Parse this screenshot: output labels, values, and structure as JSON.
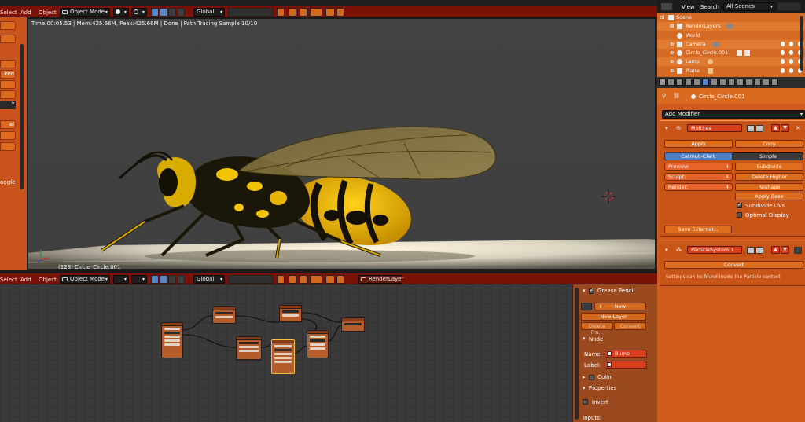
{
  "top_header": {
    "select": "Select",
    "add": "Add",
    "object": "Object",
    "mode": "Object Mode",
    "orientation": "Global"
  },
  "viewport": {
    "render_info": "Time:00:05.53 | Mem:425.66M, Peak:425.66M | Done | Path Tracing Sample 10/10",
    "object_label": "(128) Circle_Circle.001"
  },
  "left_shelf": {
    "label_ked": "ked",
    "label_al": "al",
    "label_toggle": "oggle"
  },
  "node_header": {
    "select": "Select",
    "add": "Add",
    "object": "Object",
    "mode": "Object Mode",
    "orientation": "Global",
    "render_layer": "RenderLayer"
  },
  "node_panel": {
    "grease_pencil": "Grease Pencil",
    "new": "New",
    "new_layer": "New Layer",
    "delete_frame": "Delete Fra...",
    "convert": "Convert",
    "node_section": "Node",
    "name_label": "Name:",
    "name_value": "Bump",
    "label_label": "Label:",
    "color_section": "Color",
    "properties_section": "Properties",
    "invert": "Invert",
    "inputs": "Inputs:"
  },
  "outliner": {
    "view": "View",
    "search": "Search",
    "scenes": "All Scenes",
    "items": [
      {
        "label": "Scene"
      },
      {
        "label": "RenderLayers"
      },
      {
        "label": "World"
      },
      {
        "label": "Camera"
      },
      {
        "label": "Circle_Circle.001"
      },
      {
        "label": "Lamp"
      },
      {
        "label": "Plane"
      }
    ]
  },
  "properties": {
    "context_object": "Circle_Circle.001",
    "add_modifier": "Add Modifier",
    "multires": {
      "name": "Multires",
      "apply": "Apply",
      "copy": "Copy",
      "catmull_clark": "Catmull-Clark",
      "simple": "Simple",
      "preview_label": "Preview:",
      "preview_value": "4",
      "sculpt_label": "Sculpt:",
      "sculpt_value": "4",
      "render_label": "Render:",
      "render_value": "4",
      "subdivide": "Subdivide",
      "delete_higher": "Delete Higher",
      "reshape": "Reshape",
      "apply_base": "Apply Base",
      "subdivide_uvs": "Subdivide UVs",
      "optimal_display": "Optimal Display",
      "save_external": "Save External..."
    },
    "particle": {
      "name": "ParticleSystem 1",
      "convert": "Convert",
      "note": "Settings can be found inside the Particle context"
    }
  },
  "colors": {
    "header_red": "#7a1208",
    "panel_orange": "#cf5a1c",
    "button_orange": "#de6e1e",
    "field_red": "#d8401c",
    "active_blue": "#4f7fc0"
  }
}
